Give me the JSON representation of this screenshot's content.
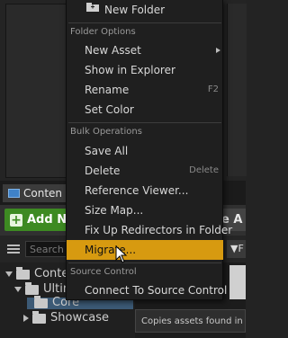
{
  "content_browser": {
    "tab_label": "Conten",
    "add_new_label": "Add N",
    "save_all_label": "e A",
    "search_placeholder": "Search",
    "filters_label": "F",
    "tree": [
      {
        "label": "Conte"
      },
      {
        "label": "Ultim"
      },
      {
        "label": "Core"
      },
      {
        "label": "Showcase"
      }
    ],
    "tooltip": "Copies assets found in"
  },
  "menu": {
    "top_items": [
      {
        "label": "New Folder"
      }
    ],
    "sections": [
      {
        "title": "Folder Options",
        "items": [
          {
            "label": "New Asset",
            "submenu": true
          },
          {
            "label": "Show in Explorer"
          },
          {
            "label": "Rename",
            "shortcut": "F2"
          },
          {
            "label": "Set Color"
          }
        ]
      },
      {
        "title": "Bulk Operations",
        "items": [
          {
            "label": "Save All"
          },
          {
            "label": "Delete",
            "shortcut": "Delete"
          },
          {
            "label": "Reference Viewer..."
          },
          {
            "label": "Size Map..."
          },
          {
            "label": "Fix Up Redirectors in Folder"
          },
          {
            "label": "Migrate...",
            "highlighted": true
          }
        ]
      },
      {
        "title": "Source Control",
        "items": [
          {
            "label": "Connect To Source Control"
          }
        ]
      }
    ],
    "highlight_color": "#d79a10"
  }
}
